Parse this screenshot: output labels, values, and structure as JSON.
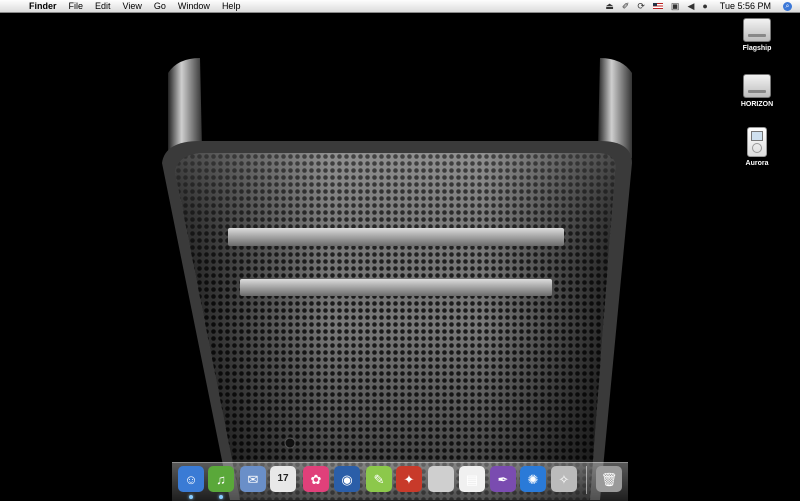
{
  "menubar": {
    "app_name": "Finder",
    "menus": [
      "File",
      "Edit",
      "View",
      "Go",
      "Window",
      "Help"
    ],
    "clock": "Tue 5:56 PM"
  },
  "desktop_icons": [
    {
      "label": "Flagship",
      "icon": "hard-drive-icon"
    },
    {
      "label": "HORIZON",
      "icon": "hard-drive-icon"
    },
    {
      "label": "Aurora",
      "icon": "ipod-icon"
    }
  ],
  "dock": [
    {
      "name": "finder",
      "icon": "finder-icon",
      "glyph": "☺",
      "color": "#3a7bd5",
      "running": true
    },
    {
      "name": "itunes",
      "icon": "itunes-icon",
      "glyph": "♫",
      "color": "#5aa83a",
      "running": true
    },
    {
      "name": "mail",
      "icon": "mail-icon",
      "glyph": "✉",
      "color": "#6a8fc8"
    },
    {
      "name": "ical",
      "icon": "calendar-icon",
      "glyph": "17",
      "color": "#e8e8e8"
    },
    {
      "name": "iphoto",
      "icon": "flower-icon",
      "glyph": "✿",
      "color": "#e0407a"
    },
    {
      "name": "iphoto-camera",
      "icon": "camera-icon",
      "glyph": "◉",
      "color": "#2b5ea8"
    },
    {
      "name": "sketch",
      "icon": "pencil-icon",
      "glyph": "✎",
      "color": "#8cc84b"
    },
    {
      "name": "photo-booth",
      "icon": "photo-booth-icon",
      "glyph": "✦",
      "color": "#c83a2a"
    },
    {
      "name": "system-preferences",
      "icon": "apple-icon",
      "glyph": "",
      "color": "#cfcfcf"
    },
    {
      "name": "textedit",
      "icon": "document-icon",
      "glyph": "▤",
      "color": "#f0f0f0"
    },
    {
      "name": "address-book",
      "icon": "pen-icon",
      "glyph": "✒",
      "color": "#7a4cb0"
    },
    {
      "name": "safari",
      "icon": "globe-icon",
      "glyph": "✺",
      "color": "#2a7ad8"
    },
    {
      "name": "compass",
      "icon": "compass-icon",
      "glyph": "✧",
      "color": "#bbbbbb"
    },
    {
      "name": "trash",
      "icon": "trash-icon",
      "glyph": "🗑",
      "color": "#9a9a9a"
    }
  ],
  "colors": {
    "wallpaper": "#000000",
    "menubar": "#e8e8e8"
  }
}
